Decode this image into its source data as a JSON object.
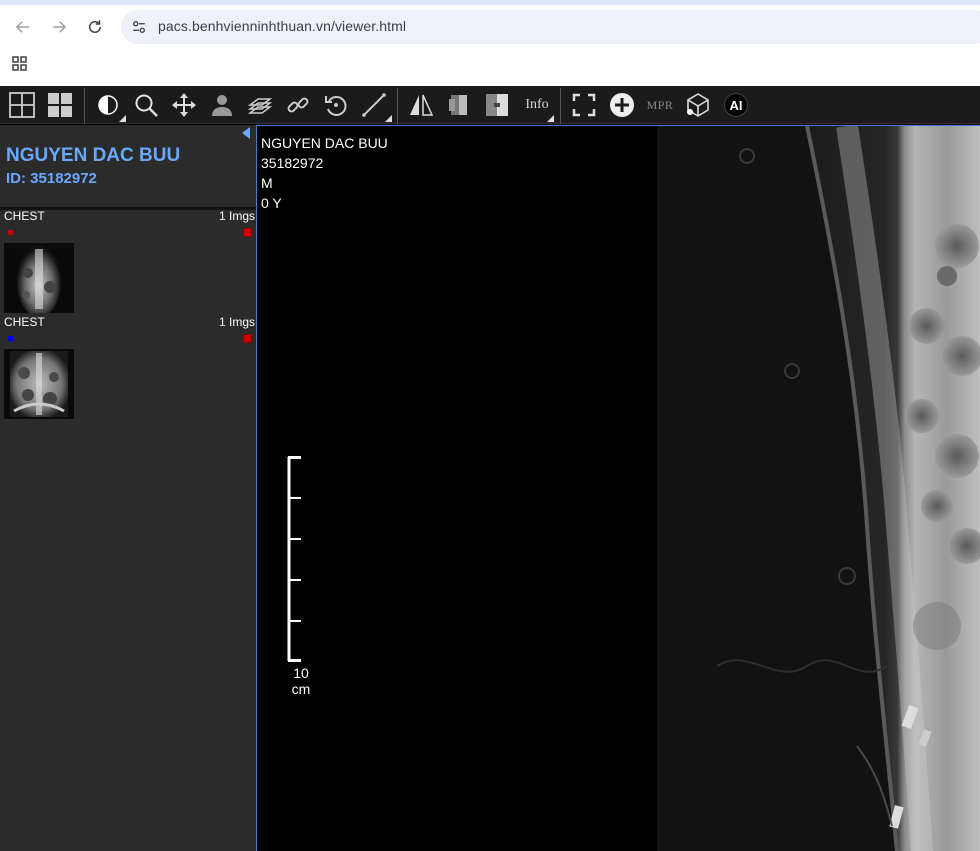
{
  "browser": {
    "url": "pacs.benhvienninhthuan.vn/viewer.html"
  },
  "toolbar": {
    "info_label": "Info",
    "mpr_label": "MPR",
    "ai_label": "AI"
  },
  "patient": {
    "name": "NGUYEN DAC BUU",
    "id_label": "ID: 35182972"
  },
  "series": [
    {
      "label": "CHEST",
      "count": "1 Imgs",
      "dot_color": "#cc0000"
    },
    {
      "label": "CHEST",
      "count": "1 Imgs",
      "dot_color": "#0000ee"
    }
  ],
  "overlay": {
    "name": "NGUYEN DAC BUU",
    "id": "35182972",
    "sex": "M",
    "age": "0 Y"
  },
  "ruler": {
    "value": "10",
    "unit": "cm"
  },
  "colors": {
    "accent": "#6aa8ff",
    "toolbar_bg": "#1b1b1b",
    "sidebar_bg": "#2b2b2b"
  }
}
